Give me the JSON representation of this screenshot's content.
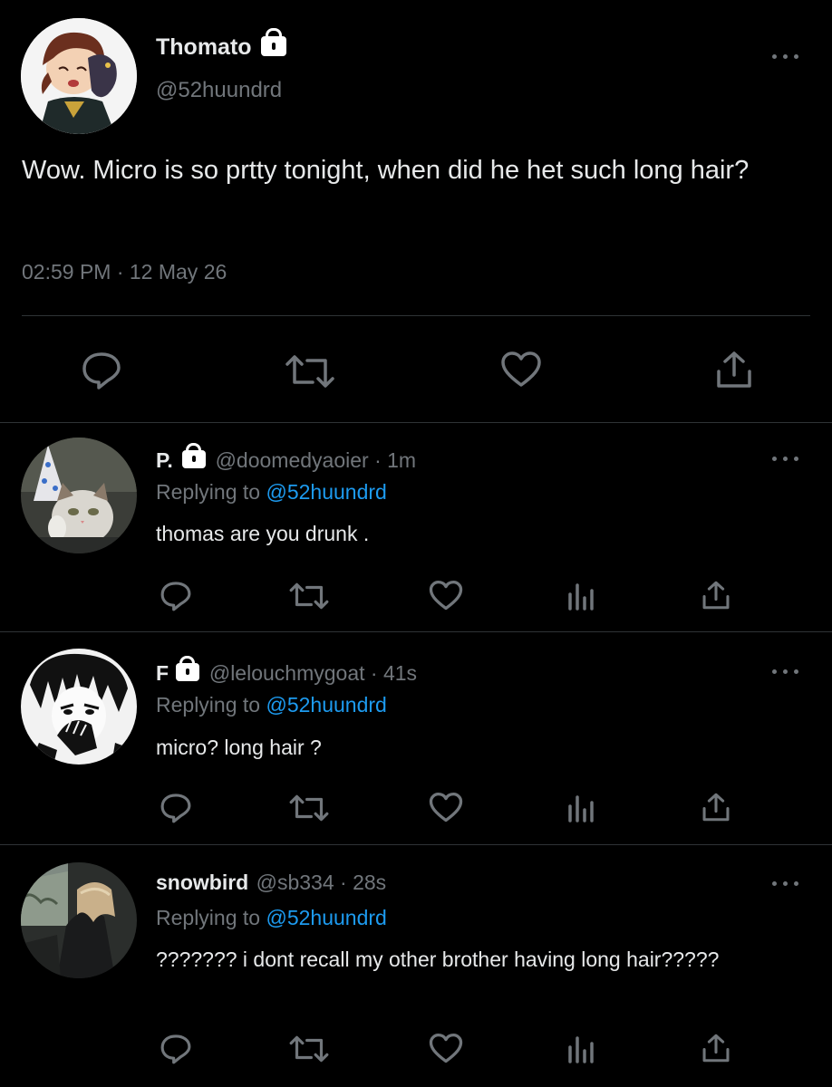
{
  "main_tweet": {
    "display_name": "Thomato",
    "handle": "@52huundrd",
    "text": "Wow. Micro is so prtty tonight, when did he het such long hair?",
    "timestamp": "02:59 PM · 12 May 26"
  },
  "replies": [
    {
      "display_name": "P.",
      "handle": "@doomedyaoier",
      "time": "· 1m",
      "replying_prefix": "Replying to",
      "replying_handle": "@52huundrd",
      "text": "thomas are you drunk ."
    },
    {
      "display_name": "F",
      "handle": "@lelouchmygoat",
      "time": "· 41s",
      "replying_prefix": "Replying to",
      "replying_handle": "@52huundrd",
      "text": "micro? long hair ?"
    },
    {
      "display_name": "snowbird",
      "handle": "@sb334",
      "time": "· 28s",
      "replying_prefix": "Replying to",
      "replying_handle": "@52huundrd",
      "text": "??????? i dont recall my other brother having long hair?????"
    }
  ],
  "colors": {
    "background": "#000000",
    "text_primary": "#e7e9ea",
    "text_secondary": "#71767b",
    "link": "#1d9bf0",
    "divider": "#2f3336"
  },
  "icons": {
    "main_actions": [
      "reply-icon",
      "retweet-icon",
      "like-icon",
      "share-icon"
    ],
    "reply_actions": [
      "reply-icon",
      "retweet-icon",
      "like-icon",
      "analytics-icon",
      "share-icon"
    ],
    "lock": "lock-icon",
    "more": "more-options-icon"
  }
}
